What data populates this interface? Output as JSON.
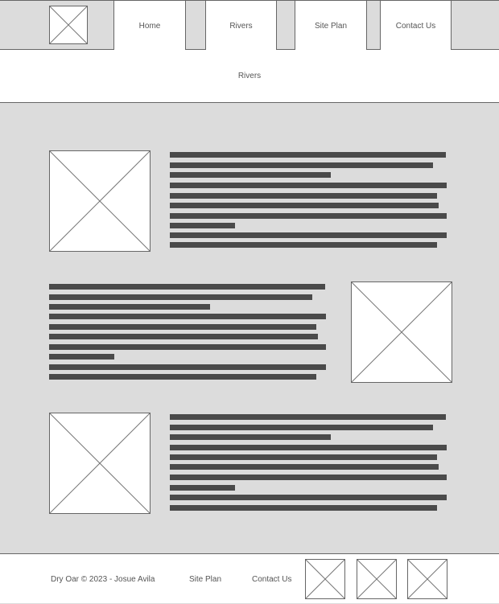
{
  "header": {
    "logo_icon": "image-placeholder-icon",
    "nav": [
      {
        "label": "Home"
      },
      {
        "label": "Rivers"
      },
      {
        "label": "Site Plan"
      },
      {
        "label": "Contact Us"
      }
    ]
  },
  "banner": {
    "title": "Rivers"
  },
  "content": {
    "sections": [
      {
        "image_icon": "image-placeholder-icon",
        "image_side": "left",
        "text_lines": 10
      },
      {
        "image_icon": "image-placeholder-icon",
        "image_side": "right",
        "text_lines": 10
      },
      {
        "image_icon": "image-placeholder-icon",
        "image_side": "left",
        "text_lines": 10
      }
    ]
  },
  "footer": {
    "copyright": "Dry Oar © 2023 - Josue Avila",
    "links": [
      {
        "label": "Site Plan"
      },
      {
        "label": "Contact Us"
      }
    ],
    "social_icons": [
      "image-placeholder-icon",
      "image-placeholder-icon",
      "image-placeholder-icon"
    ]
  },
  "colors": {
    "background": "#dcdcdc",
    "surface": "#ffffff",
    "border": "#666666",
    "text_bar": "#4a4a4a"
  }
}
